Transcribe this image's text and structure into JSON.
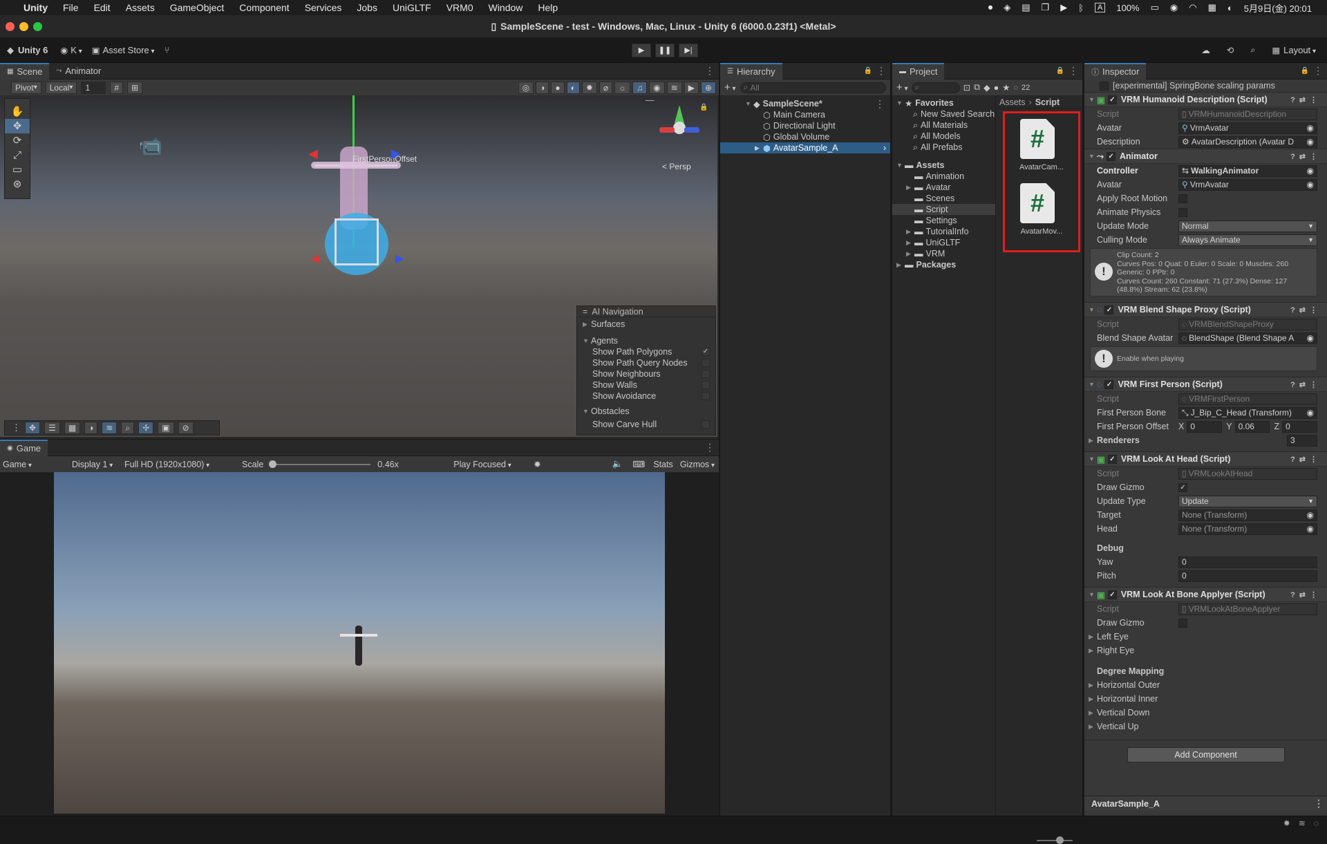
{
  "menubar": {
    "app": "Unity",
    "items": [
      "File",
      "Edit",
      "Assets",
      "GameObject",
      "Component",
      "Services",
      "Jobs",
      "UniGLTF",
      "VRM0",
      "Window",
      "Help"
    ],
    "battery": "100%",
    "datetime": "5月9日(金) 20:01"
  },
  "window": {
    "title": "SampleScene - test - Windows, Mac, Linux - Unity 6 (6000.0.23f1) <Metal>"
  },
  "toolbar": {
    "unity_label": "Unity 6",
    "account": "K",
    "asset_store": "Asset Store",
    "layout": "Layout"
  },
  "scene": {
    "tab_scene": "Scene",
    "tab_animator": "Animator",
    "pivot": "Pivot",
    "local": "Local",
    "grid_value": "1",
    "persp": "< Persp",
    "gizmo_label": "FirstPersonOffset",
    "ainav": {
      "title": "AI Navigation",
      "surfaces": "Surfaces",
      "agents": "Agents",
      "items": [
        "Show Path Polygons",
        "Show Path Query Nodes",
        "Show Neighbours",
        "Show Walls",
        "Show Avoidance"
      ],
      "obstacles": "Obstacles",
      "carve": "Show Carve Hull"
    }
  },
  "game": {
    "tab": "Game",
    "mode": "Game",
    "display": "Display 1",
    "resolution": "Full HD (1920x1080)",
    "scale_label": "Scale",
    "scale_value": "0.46x",
    "play_focused": "Play Focused",
    "stats": "Stats",
    "gizmos": "Gizmos"
  },
  "hierarchy": {
    "tab": "Hierarchy",
    "search_placeholder": "All",
    "scene": "SampleScene*",
    "items": [
      "Main Camera",
      "Directional Light",
      "Global Volume"
    ],
    "selected": "AvatarSample_A"
  },
  "project": {
    "tab": "Project",
    "count": "22",
    "favorites": "Favorites",
    "fav_items": [
      "New Saved Search",
      "All Materials",
      "All Models",
      "All Prefabs"
    ],
    "assets": "Assets",
    "asset_folders": [
      "Animation",
      "Avatar",
      "Scenes",
      "Script",
      "Settings",
      "TutorialInfo",
      "UniGLTF",
      "VRM"
    ],
    "packages": "Packages",
    "breadcrumb": [
      "Assets",
      "Script"
    ],
    "files": [
      "AvatarCam...",
      "AvatarMov..."
    ]
  },
  "inspector": {
    "tab": "Inspector",
    "top_row": "[experimental] SpringBone scaling params",
    "humanoid": {
      "title": "VRM Humanoid Description (Script)",
      "script_label": "Script",
      "script": "VRMHumanoidDescription",
      "avatar_label": "Avatar",
      "avatar": "VrmAvatar",
      "desc_label": "Description",
      "desc": "AvatarDescription (Avatar D"
    },
    "animator": {
      "title": "Animator",
      "controller_label": "Controller",
      "controller": "WalkingAnimator",
      "avatar_label": "Avatar",
      "avatar": "VrmAvatar",
      "root_motion": "Apply Root Motion",
      "physics": "Animate Physics",
      "update_label": "Update Mode",
      "update": "Normal",
      "culling_label": "Culling Mode",
      "culling": "Always Animate",
      "info": [
        "Clip Count: 2",
        "Curves Pos: 0 Quat: 0 Euler: 0 Scale: 0 Muscles: 260",
        "Generic: 0 PPtr: 0",
        "Curves Count: 260 Constant: 71 (27.3%) Dense: 127",
        "(48.8%) Stream: 62 (23.8%)"
      ]
    },
    "blend": {
      "title": "VRM Blend Shape Proxy (Script)",
      "script_label": "Script",
      "script": "VRMBlendShapeProxy",
      "avatar_label": "Blend Shape Avatar",
      "avatar": "BlendShape (Blend Shape A",
      "note": "Enable when playing"
    },
    "firstperson": {
      "title": "VRM First Person (Script)",
      "script_label": "Script",
      "script": "VRMFirstPerson",
      "bone_label": "First Person Bone",
      "bone": "J_Bip_C_Head (Transform)",
      "offset_label": "First Person Offset",
      "x_label": "X",
      "x": "0",
      "y_label": "Y",
      "y": "0.06",
      "z_label": "Z",
      "z": "0",
      "renderers_label": "Renderers",
      "renderers": "3"
    },
    "lookat": {
      "title": "VRM Look At Head (Script)",
      "script_label": "Script",
      "script": "VRMLookAtHead",
      "gizmo_label": "Draw Gizmo",
      "update_label": "Update Type",
      "update": "Update",
      "target_label": "Target",
      "target": "None (Transform)",
      "head_label": "Head",
      "head": "None (Transform)",
      "debug": "Debug",
      "yaw_label": "Yaw",
      "yaw": "0",
      "pitch_label": "Pitch",
      "pitch": "0"
    },
    "bone": {
      "title": "VRM Look At Bone Applyer (Script)",
      "script_label": "Script",
      "script": "VRMLookAtBoneApplyer",
      "gizmo_label": "Draw Gizmo",
      "left": "Left Eye",
      "right": "Right Eye",
      "mapping": "Degree Mapping",
      "items": [
        "Horizontal Outer",
        "Horizontal Inner",
        "Vertical Down",
        "Vertical Up"
      ]
    },
    "add_component": "Add Component",
    "footer": "AvatarSample_A"
  }
}
